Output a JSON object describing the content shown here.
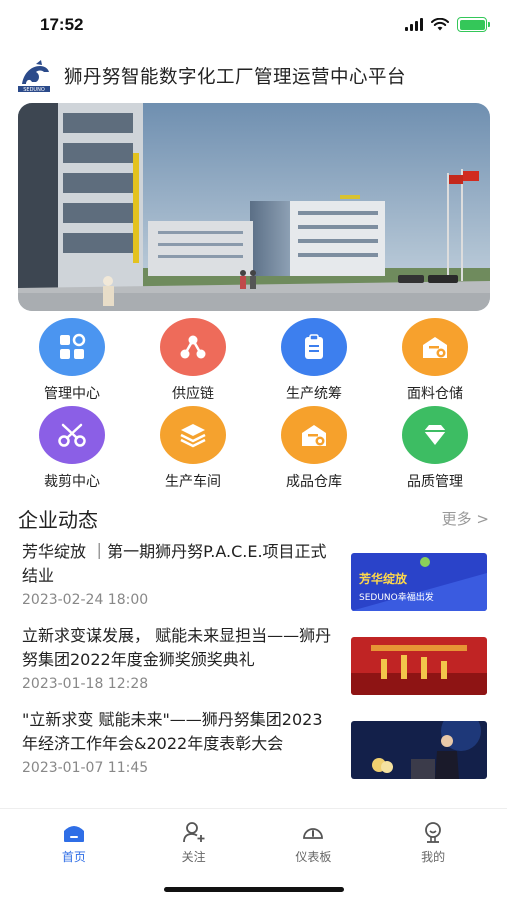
{
  "status_bar": {
    "time": "17:52"
  },
  "header": {
    "title": "狮丹努智能数字化工厂管理运营中心平台"
  },
  "banner": {
    "alt": "factory building"
  },
  "grid": [
    {
      "label": "管理中心",
      "icon": "grid-icon",
      "color": "#4b95f0"
    },
    {
      "label": "供应链",
      "icon": "network-icon",
      "color": "#ee6b5a"
    },
    {
      "label": "生产统筹",
      "icon": "clipboard-icon",
      "color": "#3d7fee"
    },
    {
      "label": "面料仓储",
      "icon": "warehouse-icon",
      "color": "#f7a12d"
    },
    {
      "label": "裁剪中心",
      "icon": "scissors-icon",
      "color": "#8b5fe6"
    },
    {
      "label": "生产车间",
      "icon": "layers-icon",
      "color": "#f5a22e"
    },
    {
      "label": "成品仓库",
      "icon": "warehouse-icon",
      "color": "#f6a12c"
    },
    {
      "label": "品质管理",
      "icon": "diamond-icon",
      "color": "#3dbd63"
    }
  ],
  "news": {
    "title": "企业动态",
    "more": "更多 >",
    "items": [
      {
        "headline": "芳华绽放 ｜第一期狮丹努P.A.C.E.项目正式结业",
        "date": "2023-02-24 18:00",
        "thumb_text": "芳华绽放",
        "thumb_sub": "SEDUNO幸福出发"
      },
      {
        "headline": "立新求变谋发展， 赋能未来显担当——狮丹努集团2022年度金狮奖颁奖典礼",
        "date": "2023-01-18 12:28"
      },
      {
        "headline": "\"立新求变 赋能未来\"——狮丹努集团2023年经济工作年会&2022年度表彰大会",
        "date": "2023-01-07 11:45"
      }
    ]
  },
  "tabbar": [
    {
      "label": "首页",
      "icon": "home-icon",
      "active": true
    },
    {
      "label": "关注",
      "icon": "user-add-icon",
      "active": false
    },
    {
      "label": "仪表板",
      "icon": "dashboard-icon",
      "active": false
    },
    {
      "label": "我的",
      "icon": "profile-icon",
      "active": false
    }
  ]
}
